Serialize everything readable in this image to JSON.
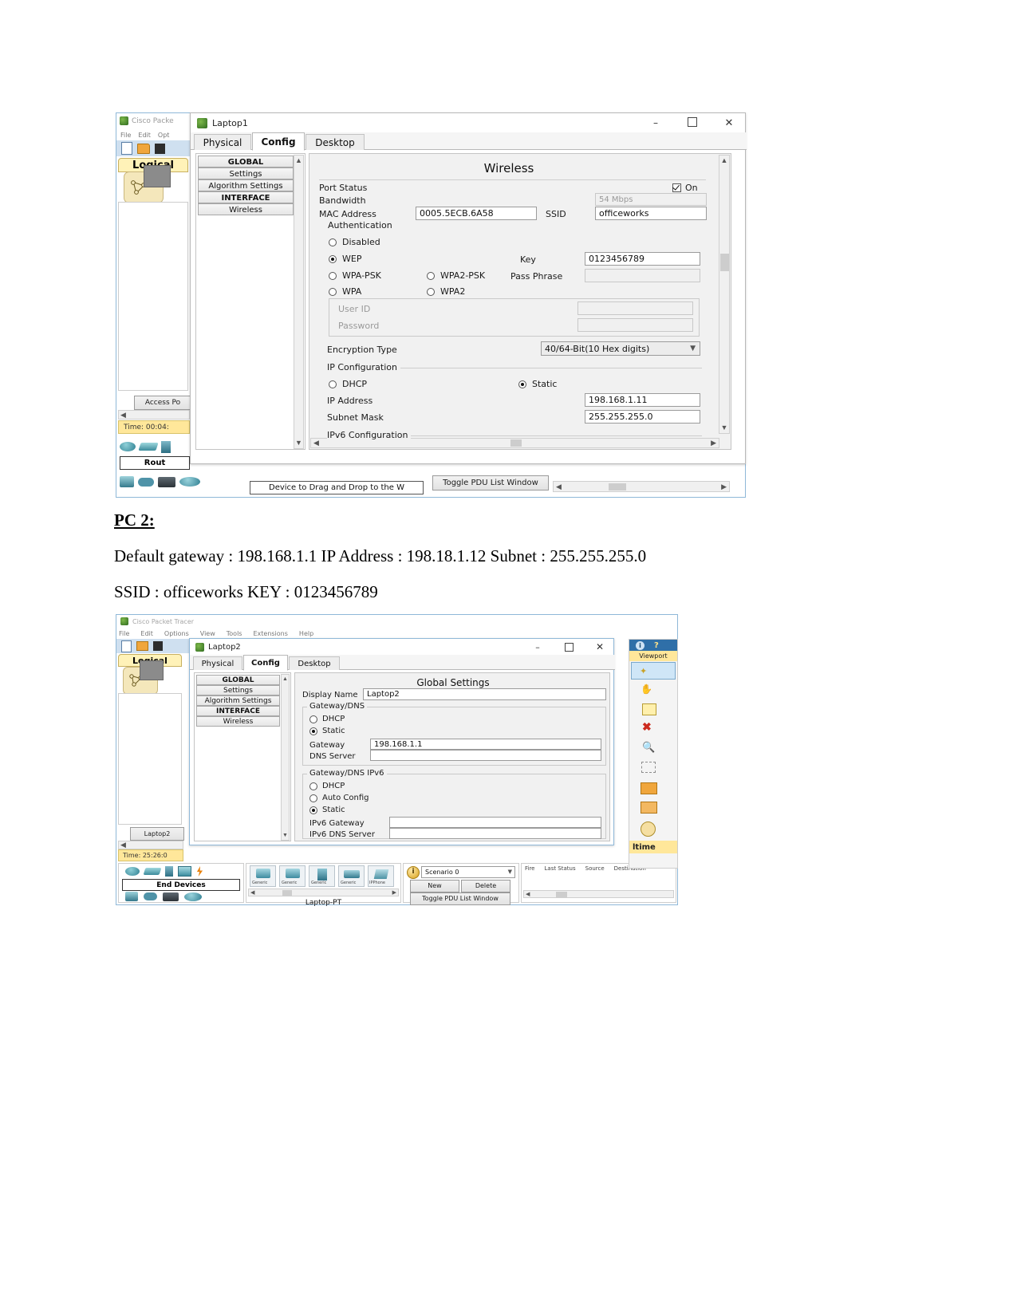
{
  "document": {
    "heading": "PC 2:",
    "line1": "Default gateway : 198.168.1.1  IP Address : 198.18.1.12     Subnet : 255.255.255.0",
    "line2": "SSID : officeworks  KEY : 0123456789"
  },
  "screenshot1": {
    "background_app": {
      "title": "Cisco Packe",
      "menus": [
        "File",
        "Edit",
        "Opt"
      ],
      "workspace_tab": "Logical",
      "device_label": "Access Po",
      "time_label": "Time: 00:04:",
      "device_group_label": "Rout",
      "drag_drop_hint": "Device to Drag and Drop to the W",
      "toggle_pdu": "Toggle PDU List Window"
    },
    "window": {
      "title": "Laptop1",
      "minimize": "–",
      "maximize": "☐",
      "close": "✕",
      "tabs": [
        {
          "label": "Physical",
          "active": false
        },
        {
          "label": "Config",
          "active": true
        },
        {
          "label": "Desktop",
          "active": false
        }
      ],
      "nav": [
        {
          "label": "GLOBAL",
          "type": "header"
        },
        {
          "label": "Settings",
          "type": "item"
        },
        {
          "label": "Algorithm Settings",
          "type": "item"
        },
        {
          "label": "INTERFACE",
          "type": "header"
        },
        {
          "label": "Wireless",
          "type": "item"
        }
      ],
      "panel": {
        "title": "Wireless",
        "port_status_label": "Port Status",
        "port_status_value": "On",
        "port_status_checked": true,
        "bandwidth_label": "Bandwidth",
        "bandwidth_value": "54 Mbps",
        "mac_label": "MAC Address",
        "mac_value": "0005.5ECB.6A58",
        "ssid_label": "SSID",
        "ssid_value": "officeworks",
        "authentication_label": "Authentication",
        "auth_options": [
          {
            "label": "Disabled",
            "selected": false
          },
          {
            "label": "WEP",
            "selected": true
          },
          {
            "label": "WPA-PSK",
            "selected": false
          },
          {
            "label": "WPA2-PSK",
            "selected": false
          },
          {
            "label": "WPA",
            "selected": false
          },
          {
            "label": "WPA2",
            "selected": false
          }
        ],
        "key_label": "Key",
        "key_value": "0123456789",
        "pass_phrase_label": "Pass Phrase",
        "pass_phrase_value": "",
        "user_id_label": "User ID",
        "user_id_value": "",
        "password_label": "Password",
        "password_value": "",
        "encryption_label": "Encryption Type",
        "encryption_value": "40/64-Bit(10 Hex digits)",
        "ip_config_label": "IP Configuration",
        "dhcp_label": "DHCP",
        "dhcp_selected": false,
        "static_label": "Static",
        "static_selected": true,
        "ip_address_label": "IP Address",
        "ip_address_value": "198.168.1.11",
        "subnet_label": "Subnet Mask",
        "subnet_value": "255.255.255.0",
        "ipv6_config_label": "IPv6 Configuration"
      }
    }
  },
  "screenshot2": {
    "background_app": {
      "title": "Cisco Packet Tracer",
      "menus": [
        "File",
        "Edit",
        "Options",
        "View",
        "Tools",
        "Extensions",
        "Help"
      ],
      "workspace_tab": "Logical",
      "device_label": "Laptop2",
      "time_label": "Time: 25:26:0",
      "viewport_label": "Viewport",
      "realtime_label": "ltime",
      "device_group_label": "End Devices",
      "device_selected_label": "Laptop-PT",
      "device_icons": [
        "Generic",
        "Generic",
        "Generic",
        "Generic",
        "IPPhone"
      ],
      "scenario_value": "Scenario 0",
      "new_button": "New",
      "delete_button": "Delete",
      "toggle_pdu": "Toggle PDU List Window",
      "pdu_columns": [
        "Fire",
        "Last Status",
        "Source",
        "Destination"
      ]
    },
    "window": {
      "title": "Laptop2",
      "minimize": "–",
      "maximize": "☐",
      "close": "✕",
      "tabs": [
        {
          "label": "Physical",
          "active": false
        },
        {
          "label": "Config",
          "active": true
        },
        {
          "label": "Desktop",
          "active": false
        }
      ],
      "nav": [
        {
          "label": "GLOBAL",
          "type": "header"
        },
        {
          "label": "Settings",
          "type": "item"
        },
        {
          "label": "Algorithm Settings",
          "type": "item"
        },
        {
          "label": "INTERFACE",
          "type": "header"
        },
        {
          "label": "Wireless",
          "type": "item"
        }
      ],
      "panel": {
        "title": "Global Settings",
        "display_name_label": "Display Name",
        "display_name_value": "Laptop2",
        "gateway_dns_legend": "Gateway/DNS",
        "dhcp_label": "DHCP",
        "dhcp_selected": false,
        "static_label": "Static",
        "static_selected": true,
        "gateway_label": "Gateway",
        "gateway_value": "198.168.1.1",
        "dns_label": "DNS Server",
        "dns_value": "",
        "gateway_dns_ipv6_legend": "Gateway/DNS IPv6",
        "ipv6_dhcp_label": "DHCP",
        "ipv6_dhcp_selected": false,
        "ipv6_auto_label": "Auto Config",
        "ipv6_auto_selected": false,
        "ipv6_static_label": "Static",
        "ipv6_static_selected": true,
        "ipv6_gateway_label": "IPv6 Gateway",
        "ipv6_gateway_value": "",
        "ipv6_dns_label": "IPv6 DNS Server",
        "ipv6_dns_value": ""
      }
    }
  },
  "colors": {
    "accent": "#2f6fa8",
    "yellow": "#ffe79a",
    "panel": "#f1f1f1"
  }
}
